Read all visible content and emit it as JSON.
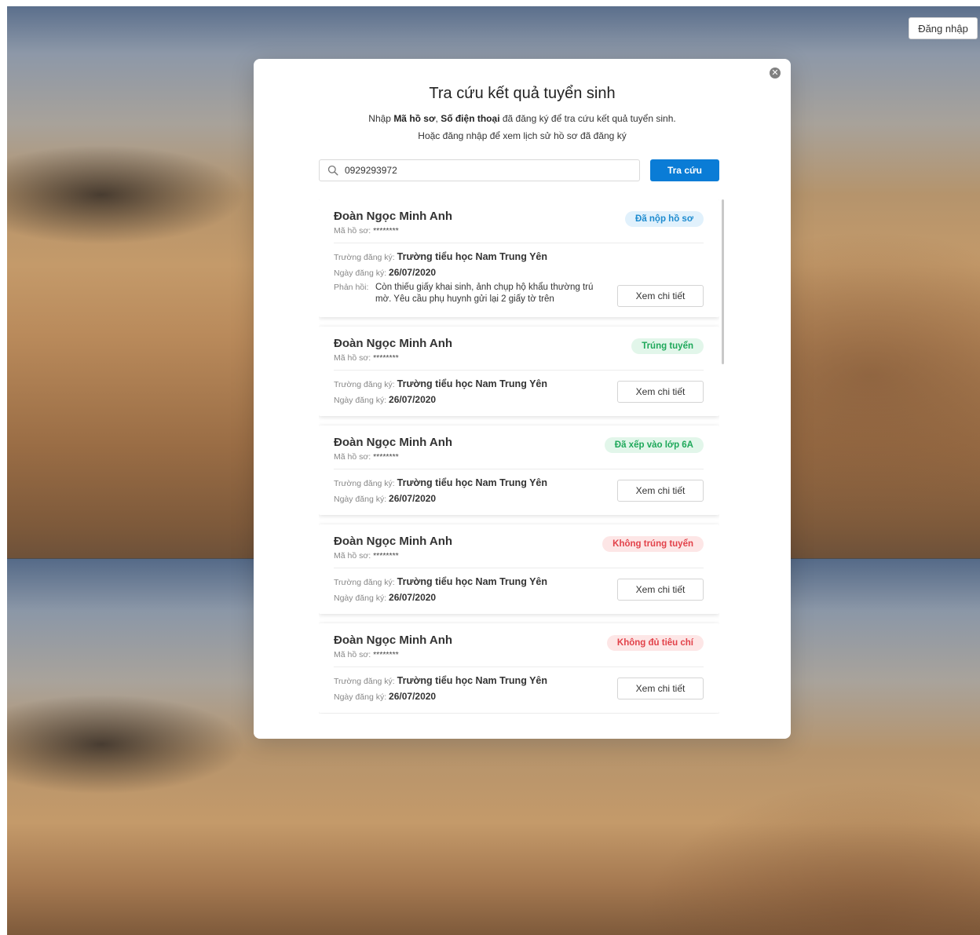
{
  "header": {
    "login_label": "Đăng nhập"
  },
  "modal": {
    "title": "Tra cứu kết quả tuyển sinh",
    "subtitle_prefix": "Nhập ",
    "subtitle_bold1": "Mã hồ sơ",
    "subtitle_sep": ", ",
    "subtitle_bold2": "Số điện thoại",
    "subtitle_suffix": " đã đăng ký để tra cứu kết quả tuyển sinh.",
    "subtitle_line2": "Hoặc đăng nhập để xem lịch sử hồ sơ đã đăng ký",
    "close_icon": "close-icon"
  },
  "search": {
    "value": "0929293972",
    "button_label": "Tra cứu",
    "icon": "search-icon"
  },
  "results": [
    {
      "name": "Đoàn Ngọc Minh Anh",
      "code_label": "Mã hồ sơ:",
      "code_value": "********",
      "status": "Đã nộp hồ sơ",
      "status_color": "#1d8bcf",
      "school_label": "Trường đăng ký:",
      "school": "Trường tiểu học Nam Trung Yên",
      "date_label": "Ngày đăng ký:",
      "date": "26/07/2020",
      "feedback_label": "Phản hồi:",
      "feedback": "Còn thiếu giấy khai sinh, ảnh chụp hộ khẩu thường trú mờ. Yêu cầu phụ huynh gửi lại 2 giấy tờ trên",
      "detail_label": "Xem chi tiết"
    },
    {
      "name": "Đoàn Ngọc Minh Anh",
      "code_label": "Mã hồ sơ:",
      "code_value": "********",
      "status": "Trúng tuyển",
      "status_color": "#1ea85a",
      "school_label": "Trường đăng ký:",
      "school": "Trường tiểu học Nam Trung Yên",
      "date_label": "Ngày đăng ký:",
      "date": "26/07/2020",
      "detail_label": "Xem chi tiết"
    },
    {
      "name": "Đoàn Ngọc Minh Anh",
      "code_label": "Mã hồ sơ:",
      "code_value": "********",
      "status": "Đã xếp vào lớp 6A",
      "status_color": "#1ea85a",
      "school_label": "Trường đăng ký:",
      "school": "Trường tiểu học Nam Trung Yên",
      "date_label": "Ngày đăng ký:",
      "date": "26/07/2020",
      "detail_label": "Xem chi tiết"
    },
    {
      "name": "Đoàn Ngọc Minh Anh",
      "code_label": "Mã hồ sơ:",
      "code_value": "********",
      "status": "Không trúng tuyển",
      "status_color": "#e2424a",
      "school_label": "Trường đăng ký:",
      "school": "Trường tiểu học Nam Trung Yên",
      "date_label": "Ngày đăng ký:",
      "date": "26/07/2020",
      "detail_label": "Xem chi tiết"
    },
    {
      "name": "Đoàn Ngọc Minh Anh",
      "code_label": "Mã hồ sơ:",
      "code_value": "********",
      "status": "Không đủ tiêu chí",
      "status_color": "#e2424a",
      "school_label": "Trường đăng ký:",
      "school": "Trường tiểu học Nam Trung Yên",
      "date_label": "Ngày đăng ký:",
      "date": "26/07/2020",
      "detail_label": "Xem chi tiết"
    }
  ]
}
